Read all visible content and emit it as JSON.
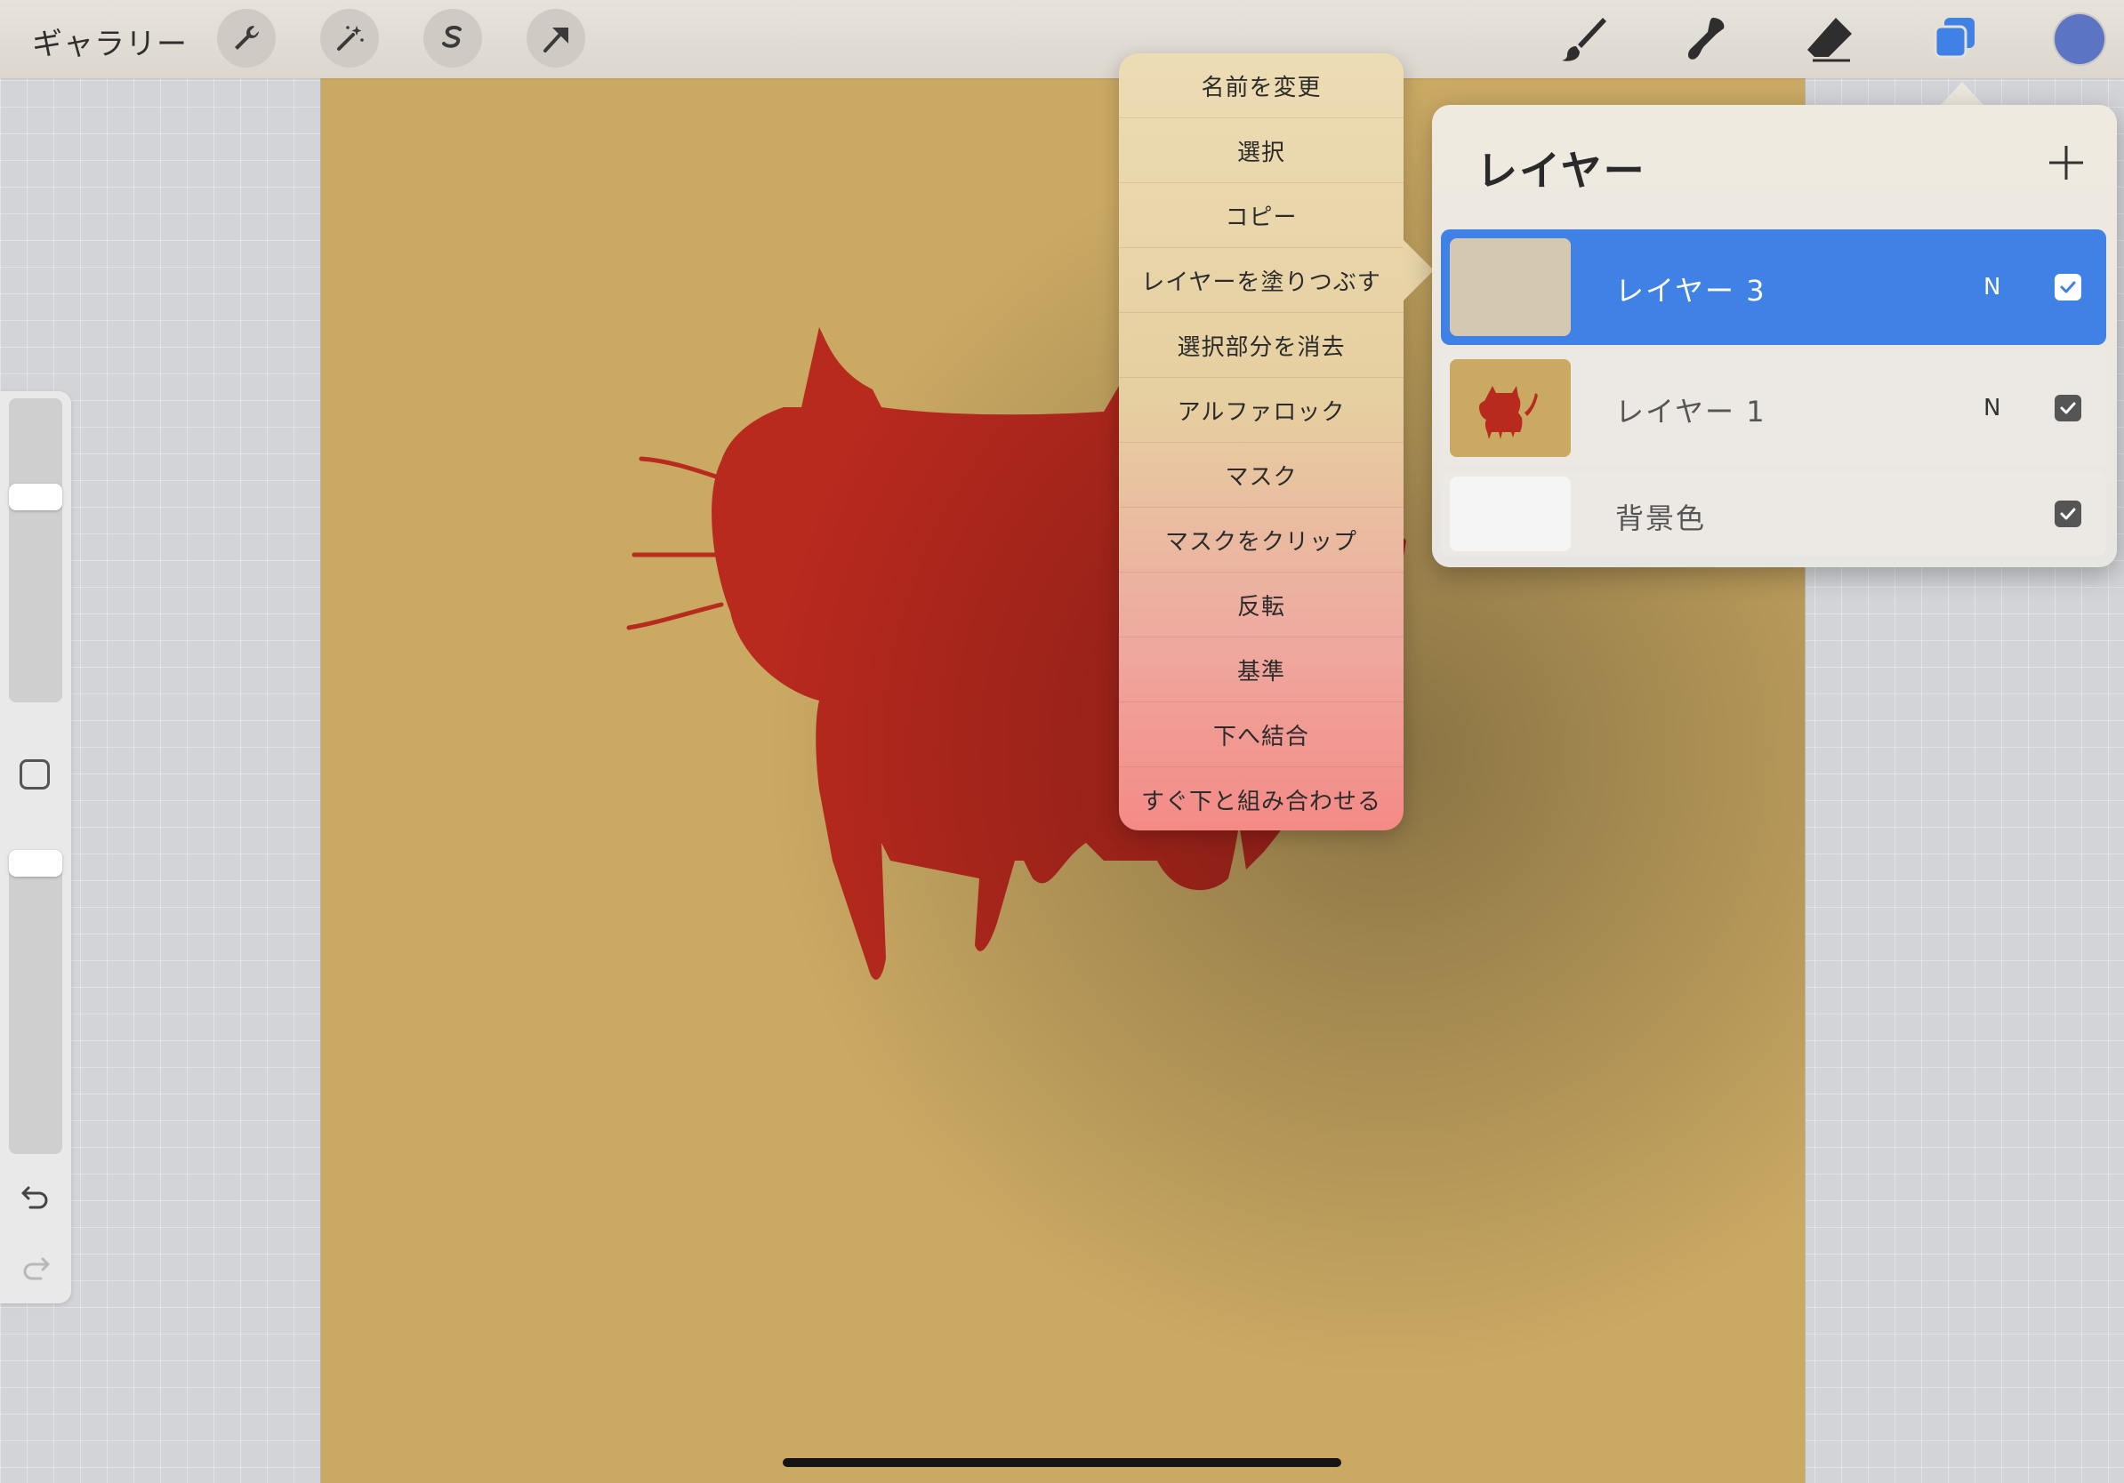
{
  "toolbar": {
    "gallery_label": "ギャラリー"
  },
  "context_menu": {
    "items": [
      "名前を変更",
      "選択",
      "コピー",
      "レイヤーを塗りつぶす",
      "選択部分を消去",
      "アルファロック",
      "マスク",
      "マスクをクリップ",
      "反転",
      "基準",
      "下へ結合",
      "すぐ下と組み合わせる"
    ]
  },
  "layers_panel": {
    "title": "レイヤー",
    "layers": [
      {
        "name": "レイヤー 3",
        "mode": "N",
        "visible": true,
        "selected": true
      },
      {
        "name": "レイヤー 1",
        "mode": "N",
        "visible": true,
        "selected": false
      },
      {
        "name": "背景色",
        "mode": "",
        "visible": true,
        "selected": false
      }
    ]
  },
  "colors": {
    "canvas": "#caa963",
    "cat": "#b8291e",
    "accent": "#3f81e4",
    "current_color": "#5b75c4"
  },
  "icons": [
    "wrench-icon",
    "magic-wand-icon",
    "selection-icon",
    "transform-arrow-icon",
    "brush-icon",
    "smudge-icon",
    "eraser-icon",
    "layers-icon",
    "plus-icon",
    "undo-icon",
    "redo-icon",
    "checkmark-icon"
  ]
}
